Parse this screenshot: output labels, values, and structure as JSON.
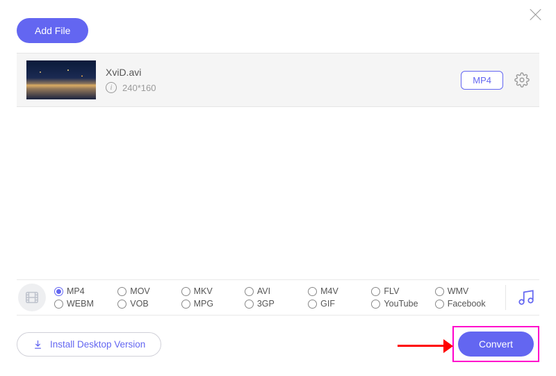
{
  "header": {
    "add_file_label": "Add File"
  },
  "file": {
    "name": "XviD.avi",
    "resolution": "240*160",
    "output_format": "MP4"
  },
  "formats": [
    {
      "id": "mp4",
      "label": "MP4",
      "checked": true
    },
    {
      "id": "mov",
      "label": "MOV",
      "checked": false
    },
    {
      "id": "mkv",
      "label": "MKV",
      "checked": false
    },
    {
      "id": "avi",
      "label": "AVI",
      "checked": false
    },
    {
      "id": "m4v",
      "label": "M4V",
      "checked": false
    },
    {
      "id": "flv",
      "label": "FLV",
      "checked": false
    },
    {
      "id": "wmv",
      "label": "WMV",
      "checked": false
    },
    {
      "id": "webm",
      "label": "WEBM",
      "checked": false
    },
    {
      "id": "vob",
      "label": "VOB",
      "checked": false
    },
    {
      "id": "mpg",
      "label": "MPG",
      "checked": false
    },
    {
      "id": "3gp",
      "label": "3GP",
      "checked": false
    },
    {
      "id": "gif",
      "label": "GIF",
      "checked": false
    },
    {
      "id": "youtube",
      "label": "YouTube",
      "checked": false
    },
    {
      "id": "facebook",
      "label": "Facebook",
      "checked": false
    }
  ],
  "footer": {
    "install_label": "Install Desktop Version",
    "convert_label": "Convert"
  },
  "colors": {
    "accent": "#6366f1",
    "highlight": "#ff00cc",
    "arrow": "#ff0000"
  }
}
